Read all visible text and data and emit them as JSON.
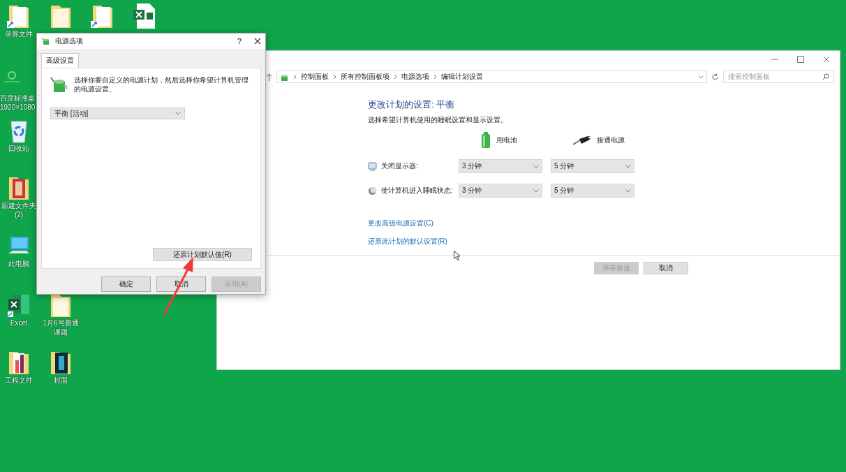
{
  "desktop_icons": [
    {
      "kind": "shortcut-folder",
      "lines": [
        "录屏文件"
      ]
    },
    {
      "kind": "folder"
    },
    {
      "kind": "shortcut-folder"
    },
    {
      "kind": "excel-file"
    },
    {
      "kind": "app",
      "lines": [
        "百度标准桌",
        "1920×1080"
      ]
    },
    {
      "kind": "recycle",
      "lines": [
        "回收站"
      ]
    },
    {
      "kind": "photo-folder",
      "lines": [
        "新建文件夹",
        "(2)"
      ]
    },
    {
      "kind": "computer",
      "lines": [
        "此电脑"
      ]
    },
    {
      "kind": "excel-app",
      "lines": [
        "Excel"
      ]
    },
    {
      "kind": "folder",
      "lines": [
        "1月6号普通",
        "课题"
      ]
    },
    {
      "kind": "doc-folder",
      "lines": [
        "工程文件"
      ]
    },
    {
      "kind": "dark-folder",
      "lines": [
        "封面"
      ]
    }
  ],
  "dialog": {
    "title": "电源选项",
    "help": "?",
    "tabs": [
      {
        "label": "高级设置",
        "selected": true
      }
    ],
    "description": "选择你要自定义的电源计划，然后选择你希望计算机管理的电源设置。",
    "plan": "平衡 [活动]",
    "restore_button": "还原计划默认值(R)",
    "buttons": [
      {
        "label": "确定",
        "disabled": false
      },
      {
        "label": "取消",
        "disabled": false
      },
      {
        "label": "应用(A)",
        "disabled": true
      }
    ]
  },
  "plan_window": {
    "breadcrumb": [
      "控制面板",
      "所有控制面板项",
      "电源选项",
      "编辑计划设置"
    ],
    "search": {
      "placeholder": "搜索控制面板"
    },
    "heading": "更改计划的设置: 平衡",
    "subtitle": "选择希望计算机使用的睡眠设置和显示设置。",
    "columns": [
      {
        "kind": "battery",
        "label": "用电池"
      },
      {
        "kind": "plug",
        "label": "接通电源"
      }
    ],
    "settings": [
      {
        "kind": "display",
        "label": "关闭显示器:",
        "values": [
          "3 分钟",
          "5 分钟"
        ]
      },
      {
        "kind": "sleep",
        "label": "使计算机进入睡眠状态:",
        "values": [
          "3 分钟",
          "5 分钟"
        ]
      }
    ],
    "links": [
      "更改高级电源设置(C)",
      "还原此计划的默认设置(R)"
    ],
    "buttons": [
      {
        "label": "保存修改",
        "disabled": true
      },
      {
        "label": "取消",
        "disabled": false
      }
    ]
  }
}
